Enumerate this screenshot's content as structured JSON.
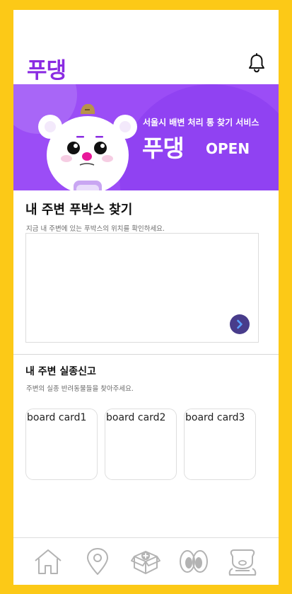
{
  "app": {
    "logo_text": "푸댕"
  },
  "banner": {
    "subtitle": "서울시 배변 처리 통 찾기 서비스",
    "title": "푸댕",
    "open_label": "OPEN"
  },
  "poobox_section": {
    "title": "내 주변 푸박스 찾기",
    "description": "지금 내 주변에 있는 푸박스의 위치를 확인하세요."
  },
  "missing_section": {
    "title": "내 주변 실종신고",
    "description": "주변의 실종 반려동물들을 찾아주세요.",
    "cards": [
      {
        "label": "board card1"
      },
      {
        "label": "board card2"
      },
      {
        "label": "board card3"
      }
    ]
  },
  "icons": {
    "notification": "bell-icon",
    "map_next": "chevron-right-icon",
    "nav": [
      "home-icon",
      "location-pin-icon",
      "box-add-icon",
      "eyes-icon",
      "dog-profile-icon"
    ]
  },
  "colors": {
    "frame": "#FCC917",
    "brand": "#8A2BE2",
    "banner": "#9B4DF6",
    "button": "#483C8B",
    "nav_icon": "#b3b3b3"
  }
}
